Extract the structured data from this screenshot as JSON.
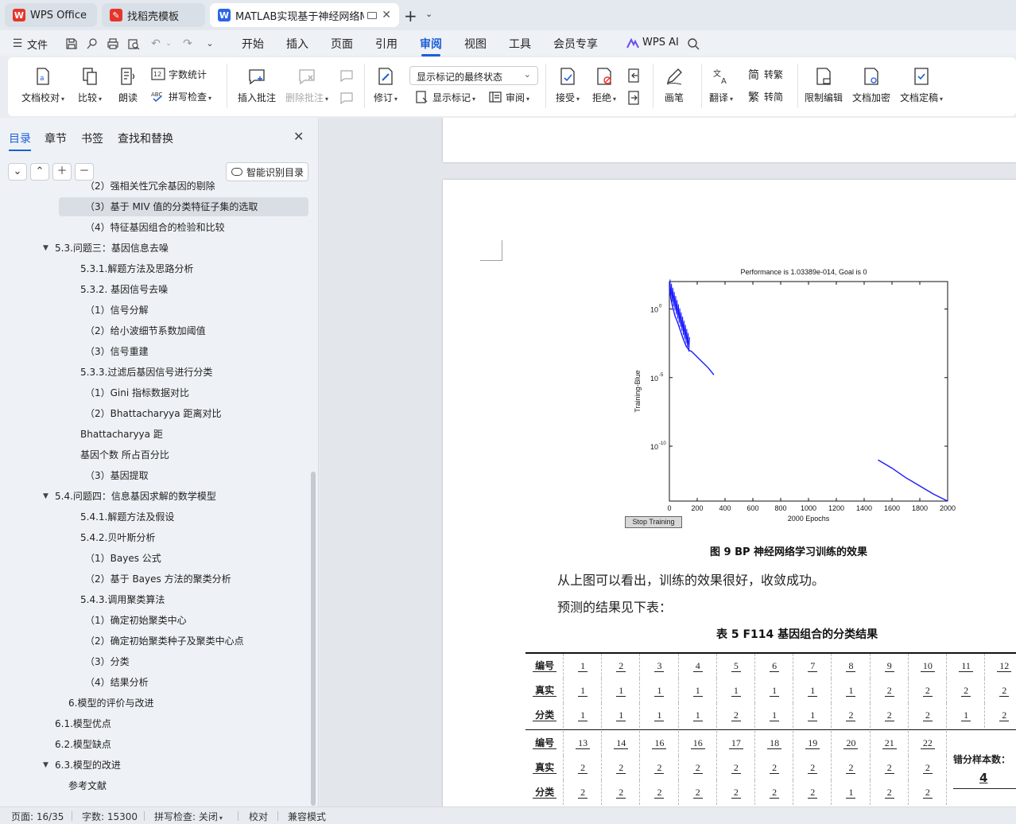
{
  "tabs": [
    {
      "label": "WPS Office",
      "logo": "W",
      "logo_color": "#e5352b"
    },
    {
      "label": "找稻壳模板",
      "logo": "✎",
      "logo_color": "#e5352b"
    },
    {
      "label": "MATLAB实现基于神经网络MI",
      "logo": "W",
      "logo_color": "#2a65e8"
    }
  ],
  "new_tab": "+",
  "menu": {
    "file": "文件",
    "items": [
      "开始",
      "插入",
      "页面",
      "引用",
      "审阅",
      "视图",
      "工具",
      "会员专享"
    ],
    "active": "审阅",
    "wps_ai": "WPS AI"
  },
  "ribbon": {
    "doc_check": "文档校对",
    "compare": "比较",
    "read_aloud": "朗读",
    "word_count": "字数统计",
    "spell_check": "拼写检查",
    "insert_comment": "插入批注",
    "delete_comment": "删除批注",
    "revise": "修订",
    "markup_state": "显示标记的最终状态",
    "show_markup": "显示标记",
    "review": "审阅",
    "accept": "接受",
    "reject": "拒绝",
    "pen": "画笔",
    "translate": "翻译",
    "to_traditional": "转繁",
    "to_simplified": "转简",
    "restrict_edit": "限制编辑",
    "encrypt": "文档加密",
    "finalize": "文档定稿"
  },
  "nav": {
    "tabs": [
      "目录",
      "章节",
      "书签",
      "查找和替换"
    ],
    "active_tab": "目录",
    "smart_toc": "智能识别目录",
    "items": [
      {
        "text": "（2）强相关性冗余基因的剔除",
        "level": 4
      },
      {
        "text": "（3）基于 MIV 值的分类特征子集的选取",
        "level": 4,
        "selected": true
      },
      {
        "text": "（4）特征基因组合的检验和比较",
        "level": 4
      },
      {
        "text": "5.3.问题三：基因信息去噪",
        "level": 2,
        "arrow": true
      },
      {
        "text": "5.3.1.解题方法及思路分析",
        "level": 3
      },
      {
        "text": "5.3.2. 基因信号去噪",
        "level": 3
      },
      {
        "text": "（1）信号分解",
        "level": 4
      },
      {
        "text": "（2）给小波细节系数加阈值",
        "level": 4
      },
      {
        "text": "（3）信号重建",
        "level": 4
      },
      {
        "text": "5.3.3.过滤后基因信号进行分类",
        "level": 3
      },
      {
        "text": "（1）Gini 指标数据对比",
        "level": 4
      },
      {
        "text": "（2）Bhattacharyya 距离对比",
        "level": 4
      },
      {
        "text": "Bhattacharyya 距",
        "level": 3
      },
      {
        "text": "基因个数 所占百分比",
        "level": 3
      },
      {
        "text": "（3）基因提取",
        "level": 4
      },
      {
        "text": "5.4.问题四：信息基因求解的数学模型",
        "level": 2,
        "arrow": true
      },
      {
        "text": "5.4.1.解题方法及假设",
        "level": 3
      },
      {
        "text": "5.4.2.贝叶斯分析",
        "level": 3
      },
      {
        "text": "（1）Bayes 公式",
        "level": 4
      },
      {
        "text": "（2）基于 Bayes 方法的聚类分析",
        "level": 4
      },
      {
        "text": "5.4.3.调用聚类算法",
        "level": 3
      },
      {
        "text": "（1）确定初始聚类中心",
        "level": 4
      },
      {
        "text": "（2）确定初始聚类种子及聚类中心点",
        "level": 4
      },
      {
        "text": "（3）分类",
        "level": 4
      },
      {
        "text": "（4）结果分析",
        "level": 4
      },
      {
        "text": "6.模型的评价与改进",
        "level": 1
      },
      {
        "text": "6.1.模型优点",
        "level": 2
      },
      {
        "text": "6.2.模型缺点",
        "level": 2
      },
      {
        "text": "6.3.模型的改进",
        "level": 2,
        "arrow": true
      },
      {
        "text": "参考文献",
        "level": 1
      }
    ]
  },
  "document": {
    "figure_caption": "图 9    BP 神经网络学习训练的效果",
    "para1": "从上图可以看出，训练的效果很好，收敛成功。",
    "para2": "预测的结果见下表：",
    "table_caption": "表 5    F114 基因组合的分类结果",
    "table": {
      "row_headers": [
        "编号",
        "真实",
        "分类"
      ],
      "block1": {
        "ids": [
          "1",
          "2",
          "3",
          "4",
          "5",
          "6",
          "7",
          "8",
          "9",
          "10",
          "11",
          "12"
        ],
        "actual": [
          "1",
          "1",
          "1",
          "1",
          "1",
          "1",
          "1",
          "1",
          "2",
          "2",
          "2",
          "2"
        ],
        "predicted": [
          "1",
          "1",
          "1",
          "1",
          "2",
          "1",
          "1",
          "2",
          "2",
          "2",
          "1",
          "2"
        ]
      },
      "block2": {
        "ids": [
          "13",
          "14",
          "16",
          "16",
          "17",
          "18",
          "19",
          "20",
          "21",
          "22"
        ],
        "actual": [
          "2",
          "2",
          "2",
          "2",
          "2",
          "2",
          "2",
          "2",
          "2",
          "2"
        ],
        "predicted": [
          "2",
          "2",
          "2",
          "2",
          "2",
          "2",
          "2",
          "1",
          "2",
          "2"
        ]
      },
      "error_label": "错分样本数：",
      "error_count": "4"
    }
  },
  "chart_data": {
    "type": "line",
    "title": "Performance is 1.03389e-014,  Goal is 0",
    "xlabel": "2000 Epochs",
    "ylabel": "Training-Blue",
    "xlim": [
      0,
      2000
    ],
    "x_ticks": [
      "0",
      "200",
      "400",
      "600",
      "800",
      "1000",
      "1200",
      "1400",
      "1600",
      "1800",
      "2000"
    ],
    "y_scale": "log",
    "ylim_exp": [
      -14,
      2
    ],
    "y_ticks": [
      {
        "base": "10",
        "exp": "0"
      },
      {
        "base": "10",
        "exp": "-5"
      },
      {
        "base": "10",
        "exp": "-10"
      }
    ],
    "color": "#1a1aff",
    "series": [
      {
        "segment": 1,
        "x": [
          0,
          10,
          20,
          30,
          40,
          60,
          80,
          100,
          120,
          140,
          160,
          200,
          240,
          280,
          320
        ],
        "log10_y": [
          1.7,
          0.8,
          0.3,
          -0.1,
          -0.5,
          -1.0,
          -1.6,
          -2.2,
          -2.7,
          -3.0,
          -3.1,
          -3.5,
          -3.9,
          -4.3,
          -4.8
        ]
      },
      {
        "segment": 2,
        "x": [
          1500,
          1600,
          1700,
          1800,
          1900,
          2000
        ],
        "log10_y": [
          -11.0,
          -11.6,
          -12.3,
          -12.9,
          -13.5,
          -14.0
        ]
      }
    ],
    "button": "Stop Training"
  },
  "status": {
    "page": "页面: 16/35",
    "words": "字数: 15300",
    "spell": "拼写检查: 关闭",
    "proof": "校对",
    "compat": "兼容模式"
  }
}
